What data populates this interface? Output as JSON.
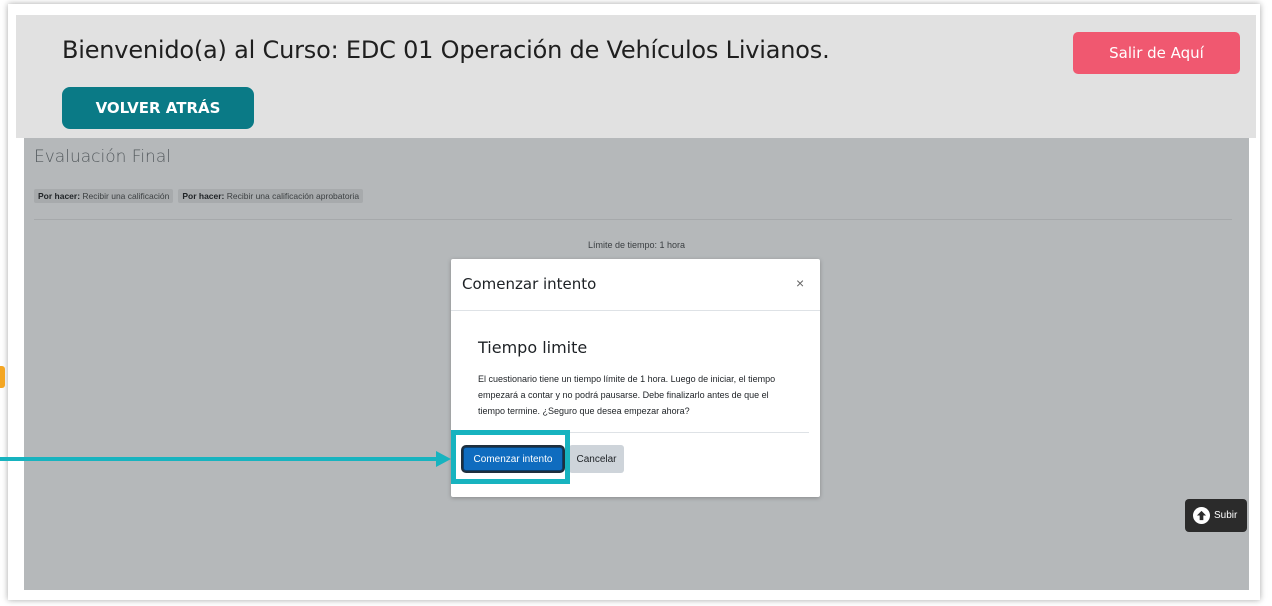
{
  "header": {
    "title": "Bienvenido(a) al Curso: EDC 01 Operación de Vehículos Livianos.",
    "exit_label": "Salir de Aquí",
    "back_label": "VOLVER ATRÁS"
  },
  "page": {
    "section_title": "Evaluación Final",
    "badges": [
      {
        "bold": "Por hacer:",
        "text": " Recibir una calificación"
      },
      {
        "bold": "Por hacer:",
        "text": " Recibir una calificación aprobatoria"
      }
    ],
    "time_limit": "Límite de tiempo: 1 hora",
    "up_label": "Subir"
  },
  "modal": {
    "title": "Comenzar intento",
    "close_symbol": "×",
    "subtitle": "Tiempo limite",
    "body": "El cuestionario tiene un tiempo límite de 1 hora. Luego de iniciar, el tiempo empezará a contar y no podrá pausarse. Debe finalizarlo antes de que el tiempo termine. ¿Seguro que desea empezar ahora?",
    "start_label": "Comenzar intento",
    "cancel_label": "Cancelar"
  },
  "colors": {
    "exit_button": "#f05870",
    "back_button": "#0a7a86",
    "start_button": "#0f6cbf",
    "highlight": "#17b3bf",
    "overlay": "#b5b8ba"
  },
  "icons": {
    "up": "arrow-up-circle-icon",
    "close": "close-icon",
    "annotation": "arrow-right-icon"
  }
}
